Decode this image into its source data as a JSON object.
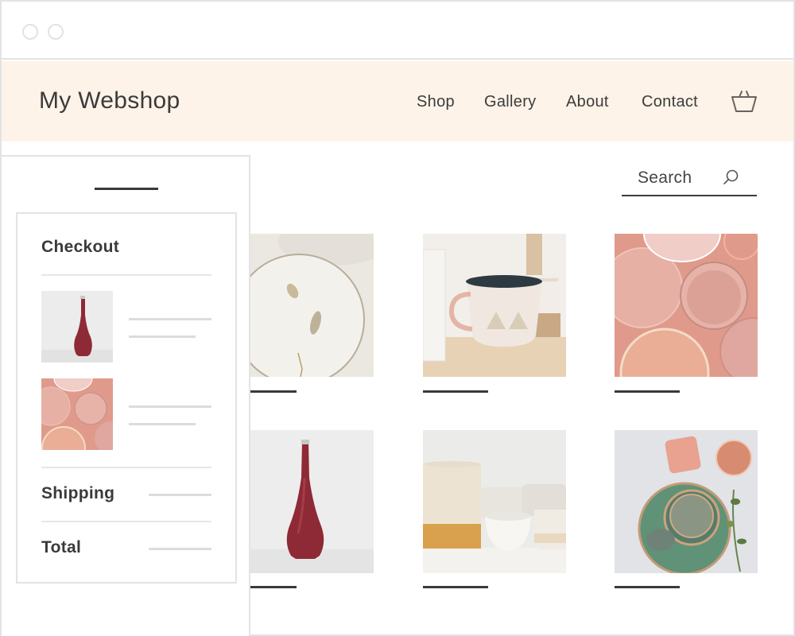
{
  "window": {
    "controls": [
      "window-dot",
      "window-dot"
    ]
  },
  "header": {
    "logo": "My Webshop",
    "nav": [
      {
        "label": "Shop"
      },
      {
        "label": "Gallery"
      },
      {
        "label": "About"
      },
      {
        "label": "Contact"
      }
    ],
    "cart_icon": "basket-icon",
    "background": "#fdf3e8"
  },
  "search": {
    "label": "Search",
    "icon": "search-icon"
  },
  "products": [
    {
      "image": "white ceramic plate with gold speckles"
    },
    {
      "image": "ceramic mugs on wooden shelf"
    },
    {
      "image": "pink plates and bowls on pink surface"
    },
    {
      "image": "red glazed bud vase"
    },
    {
      "image": "speckled cream and white cups"
    },
    {
      "image": "green plates with pink mugs and greenery"
    }
  ],
  "checkout": {
    "title": "Checkout",
    "items": [
      {
        "image": "red glazed bud vase"
      },
      {
        "image": "pink plates and bowls on pink surface"
      }
    ],
    "shipping_label": "Shipping",
    "total_label": "Total"
  }
}
